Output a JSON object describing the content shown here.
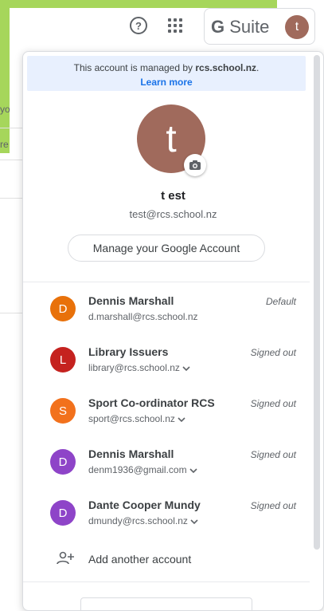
{
  "topbar": {
    "help_glyph": "?",
    "suite_label_g": "G",
    "suite_label": "Suite",
    "avatar_letter": "t"
  },
  "background": {
    "snippets": [
      "yo",
      "re"
    ]
  },
  "popup": {
    "managed_prefix": "This account is managed by ",
    "managed_domain": "rcs.school.nz",
    "managed_suffix": ".",
    "learn_more": "Learn more",
    "avatar_letter": "t",
    "name": "t est",
    "email": "test@rcs.school.nz",
    "manage_button": "Manage your Google Account",
    "add_account": "Add another account",
    "accounts": [
      {
        "letter": "D",
        "name": "Dennis Marshall",
        "email": "d.marshall@rcs.school.nz",
        "status": "Default",
        "color": "#e8710a",
        "chevron": false
      },
      {
        "letter": "L",
        "name": "Library Issuers",
        "email": "library@rcs.school.nz",
        "status": "Signed out",
        "color": "#c5221f",
        "chevron": true
      },
      {
        "letter": "S",
        "name": "Sport Co-ordinator RCS",
        "email": "sport@rcs.school.nz",
        "status": "Signed out",
        "color": "#f2711c",
        "chevron": true
      },
      {
        "letter": "D",
        "name": "Dennis Marshall",
        "email": "denm1936@gmail.com",
        "status": "Signed out",
        "color": "#8e44c8",
        "chevron": true
      },
      {
        "letter": "D",
        "name": "Dante Cooper Mundy",
        "email": "dmundy@rcs.school.nz",
        "status": "Signed out",
        "color": "#8e44c8",
        "chevron": true
      }
    ]
  },
  "colors": {
    "accent": "#1a73e8",
    "avatar": "#a06a5c",
    "banner": "#e8f0fe",
    "page_green": "#a6d65b"
  }
}
